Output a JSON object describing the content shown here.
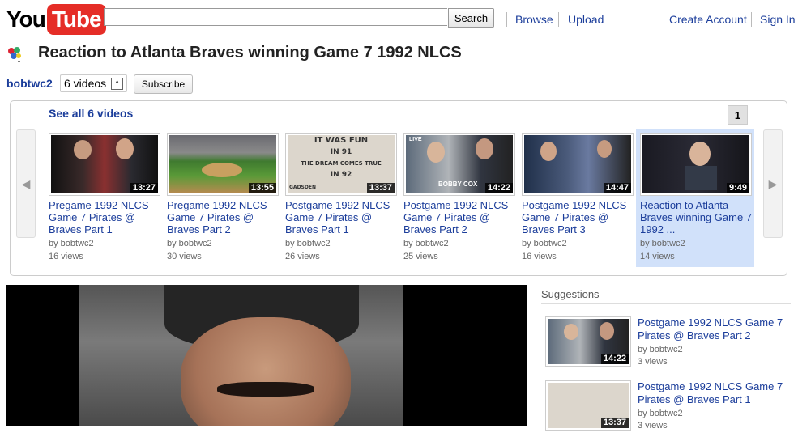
{
  "brand": {
    "you": "You",
    "tube": "Tube"
  },
  "search": {
    "value": "",
    "button": "Search"
  },
  "nav": {
    "browse": "Browse",
    "upload": "Upload",
    "create_account": "Create Account",
    "sign_in": "Sign In"
  },
  "video": {
    "title": "Reaction to Atlanta Braves winning Game 7 1992 NLCS",
    "channel": "bobtwc2",
    "count_label": "6 videos",
    "subscribe": "Subscribe"
  },
  "playlist": {
    "see_all": "See all 6 videos",
    "page": "1",
    "items": [
      {
        "title": "Pregame 1992 NLCS Game 7 Pirates @ Braves Part 1",
        "duration": "13:27",
        "by": "by bobtwc2",
        "views": "16 views"
      },
      {
        "title": "Pregame 1992 NLCS Game 7 Pirates @ Braves Part 2",
        "duration": "13:55",
        "by": "by bobtwc2",
        "views": "30 views"
      },
      {
        "title": "Postgame 1992 NLCS Game 7 Pirates @ Braves Part 1",
        "duration": "13:37",
        "by": "by bobtwc2",
        "views": "26 views"
      },
      {
        "title": "Postgame 1992 NLCS Game 7 Pirates @ Braves Part 2",
        "duration": "14:22",
        "by": "by bobtwc2",
        "views": "25 views"
      },
      {
        "title": "Postgame 1992 NLCS Game 7 Pirates @ Braves Part 3",
        "duration": "14:47",
        "by": "by bobtwc2",
        "views": "16 views"
      },
      {
        "title": "Reaction to Atlanta Braves winning Game 7 1992 ...",
        "duration": "9:49",
        "by": "by bobtwc2",
        "views": "14 views"
      }
    ]
  },
  "suggestions": {
    "title": "Suggestions",
    "items": [
      {
        "title": "Postgame 1992 NLCS Game 7 Pirates @ Braves Part 2",
        "duration": "14:22",
        "by": "by bobtwc2",
        "views": "3 views"
      },
      {
        "title": "Postgame 1992 NLCS Game 7 Pirates @ Braves Part 1",
        "duration": "13:37",
        "by": "by bobtwc2",
        "views": "3 views"
      }
    ]
  },
  "thumb_text": {
    "sign": [
      "IT WAS FUN",
      "IN 91",
      "THE DREAM COMES TRUE",
      "IN 92"
    ],
    "sign_name": "GADSDEN",
    "bobby": "BOBBY COX",
    "live": "LIVE"
  }
}
